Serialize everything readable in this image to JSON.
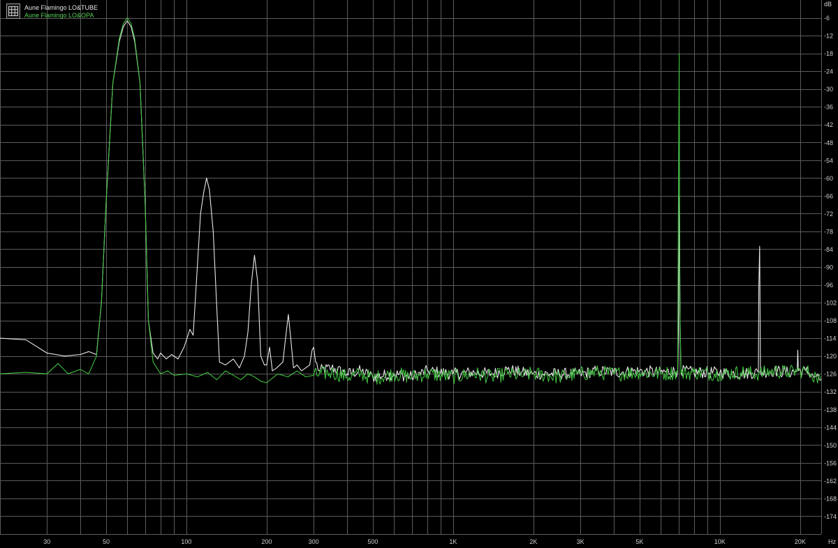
{
  "legend": {
    "icon": "grid-icon",
    "series_labels": [
      "Aune Flamingo LO&TUBE",
      "Aune Flamingo LO&OPA"
    ]
  },
  "chart_data": {
    "type": "line",
    "xscale": "log",
    "xlim": [
      20,
      24000
    ],
    "ylim": [
      -180,
      0
    ],
    "xunit": "Hz",
    "yunit": "dB",
    "x_ticks": [
      {
        "value": 30,
        "label": "30"
      },
      {
        "value": 50,
        "label": "50"
      },
      {
        "value": 100,
        "label": "100"
      },
      {
        "value": 200,
        "label": "200"
      },
      {
        "value": 300,
        "label": "300"
      },
      {
        "value": 500,
        "label": "500"
      },
      {
        "value": 1000,
        "label": "1K"
      },
      {
        "value": 2000,
        "label": "2K"
      },
      {
        "value": 3000,
        "label": "3K"
      },
      {
        "value": 5000,
        "label": "5K"
      },
      {
        "value": 10000,
        "label": "10K"
      },
      {
        "value": 20000,
        "label": "20K"
      }
    ],
    "x_gridlines": [
      20,
      30,
      40,
      50,
      60,
      70,
      80,
      90,
      100,
      200,
      300,
      400,
      500,
      600,
      700,
      800,
      900,
      1000,
      2000,
      3000,
      4000,
      5000,
      6000,
      7000,
      8000,
      9000,
      10000,
      20000
    ],
    "y_ticks": [
      -6,
      -12,
      -18,
      -24,
      -30,
      -36,
      -42,
      -48,
      -54,
      -60,
      -66,
      -72,
      -78,
      -84,
      -90,
      -96,
      -102,
      -108,
      -114,
      -120,
      -126,
      -132,
      -138,
      -144,
      -150,
      -156,
      -162,
      -168,
      -174
    ],
    "grid": true,
    "legend_position": "top-left",
    "colors": {
      "background": "#000000",
      "grid": "#5c5c5c",
      "tube": "#e8e8e8",
      "opa": "#3fbf3f",
      "axis_text": "#d0d0d0"
    },
    "series": [
      {
        "name": "Aune Flamingo LO&TUBE",
        "color": "#e8e8e8",
        "points": [
          [
            20,
            -114
          ],
          [
            25,
            -114.5
          ],
          [
            30,
            -119
          ],
          [
            35,
            -120
          ],
          [
            40,
            -119.5
          ],
          [
            43,
            -118.5
          ],
          [
            46,
            -119.5
          ],
          [
            48,
            -102
          ],
          [
            50,
            -68
          ],
          [
            53,
            -28
          ],
          [
            56,
            -14
          ],
          [
            58,
            -9
          ],
          [
            60,
            -7
          ],
          [
            62,
            -9
          ],
          [
            64,
            -14
          ],
          [
            67,
            -28
          ],
          [
            70,
            -68
          ],
          [
            72,
            -108
          ],
          [
            75,
            -119
          ],
          [
            78,
            -121
          ],
          [
            80,
            -119
          ],
          [
            84,
            -121
          ],
          [
            88,
            -119.5
          ],
          [
            93,
            -121
          ],
          [
            98,
            -117
          ],
          [
            103,
            -111
          ],
          [
            106,
            -113
          ],
          [
            110,
            -89
          ],
          [
            113,
            -72
          ],
          [
            116,
            -65
          ],
          [
            119,
            -60
          ],
          [
            122,
            -64
          ],
          [
            126,
            -78
          ],
          [
            130,
            -104
          ],
          [
            133,
            -122
          ],
          [
            140,
            -123
          ],
          [
            150,
            -121
          ],
          [
            158,
            -124
          ],
          [
            165,
            -120
          ],
          [
            170,
            -112
          ],
          [
            175,
            -96
          ],
          [
            180,
            -86
          ],
          [
            185,
            -95
          ],
          [
            190,
            -120
          ],
          [
            196,
            -123
          ],
          [
            200,
            -123
          ],
          [
            205,
            -117
          ],
          [
            210,
            -125
          ],
          [
            218,
            -124
          ],
          [
            230,
            -122
          ],
          [
            236,
            -113
          ],
          [
            241,
            -106
          ],
          [
            246,
            -114
          ],
          [
            252,
            -124
          ],
          [
            260,
            -123
          ],
          [
            270,
            -125
          ],
          [
            280,
            -124
          ],
          [
            290,
            -123
          ],
          [
            296,
            -118
          ],
          [
            300,
            -117
          ],
          [
            305,
            -122
          ],
          [
            315,
            -125
          ],
          [
            350,
            -124
          ],
          [
            400,
            -126
          ],
          [
            450,
            -125
          ],
          [
            500,
            -127
          ],
          [
            600,
            -126
          ],
          [
            700,
            -127
          ],
          [
            800,
            -125
          ],
          [
            1000,
            -126
          ],
          [
            1200,
            -125.5
          ],
          [
            1400,
            -126
          ],
          [
            1600,
            -124.5
          ],
          [
            1800,
            -125.5
          ],
          [
            2000,
            -126
          ],
          [
            2500,
            -126
          ],
          [
            3000,
            -126
          ],
          [
            3500,
            -125
          ],
          [
            4000,
            -125.5
          ],
          [
            5000,
            -125
          ],
          [
            6000,
            -125.5
          ],
          [
            6950,
            -125
          ],
          [
            7000,
            -109
          ],
          [
            7050,
            -66
          ],
          [
            7100,
            -110
          ],
          [
            7150,
            -125
          ],
          [
            8000,
            -125.5
          ],
          [
            10000,
            -125.5
          ],
          [
            12000,
            -126
          ],
          [
            13950,
            -125.5
          ],
          [
            14000,
            -97
          ],
          [
            14100,
            -83
          ],
          [
            14200,
            -125.5
          ],
          [
            16000,
            -125
          ],
          [
            18000,
            -125.5
          ],
          [
            19500,
            -125
          ],
          [
            19600,
            -118
          ],
          [
            19700,
            -125
          ],
          [
            21000,
            -125
          ],
          [
            22000,
            -126
          ],
          [
            23000,
            -127
          ],
          [
            24000,
            -128
          ]
        ]
      },
      {
        "name": "Aune Flamingo LO&OPA",
        "color": "#3fbf3f",
        "points": [
          [
            20,
            -126
          ],
          [
            25,
            -125.5
          ],
          [
            30,
            -126
          ],
          [
            33,
            -122.5
          ],
          [
            36,
            -126
          ],
          [
            40,
            -124.5
          ],
          [
            43,
            -126
          ],
          [
            46,
            -120
          ],
          [
            48,
            -102
          ],
          [
            50,
            -68
          ],
          [
            53,
            -28
          ],
          [
            56,
            -13
          ],
          [
            58,
            -8
          ],
          [
            60,
            -6
          ],
          [
            62,
            -8
          ],
          [
            64,
            -13
          ],
          [
            67,
            -28
          ],
          [
            70,
            -68
          ],
          [
            72,
            -108
          ],
          [
            75,
            -122
          ],
          [
            80,
            -126
          ],
          [
            85,
            -125
          ],
          [
            90,
            -126.5
          ],
          [
            100,
            -126
          ],
          [
            110,
            -127
          ],
          [
            120,
            -125.5
          ],
          [
            130,
            -128
          ],
          [
            140,
            -125
          ],
          [
            150,
            -126.5
          ],
          [
            160,
            -128
          ],
          [
            170,
            -126
          ],
          [
            180,
            -127
          ],
          [
            190,
            -128.5
          ],
          [
            200,
            -129
          ],
          [
            220,
            -126
          ],
          [
            240,
            -127
          ],
          [
            260,
            -125
          ],
          [
            280,
            -127
          ],
          [
            300,
            -126.5
          ],
          [
            350,
            -125.5
          ],
          [
            400,
            -127
          ],
          [
            450,
            -126
          ],
          [
            500,
            -127.5
          ],
          [
            600,
            -126
          ],
          [
            700,
            -127
          ],
          [
            800,
            -126
          ],
          [
            1000,
            -127
          ],
          [
            1200,
            -126
          ],
          [
            1400,
            -127
          ],
          [
            1600,
            -126
          ],
          [
            1800,
            -126.5
          ],
          [
            2000,
            -126
          ],
          [
            2500,
            -127
          ],
          [
            3000,
            -126
          ],
          [
            3500,
            -125.5
          ],
          [
            4000,
            -126
          ],
          [
            5000,
            -125.5
          ],
          [
            6000,
            -126
          ],
          [
            6950,
            -125.5
          ],
          [
            7000,
            -60
          ],
          [
            7040,
            -18
          ],
          [
            7080,
            -100
          ],
          [
            7150,
            -126
          ],
          [
            8000,
            -125.5
          ],
          [
            10000,
            -126
          ],
          [
            12000,
            -125.5
          ],
          [
            14000,
            -126
          ],
          [
            16000,
            -125
          ],
          [
            18000,
            -125.5
          ],
          [
            20000,
            -125
          ],
          [
            21000,
            -125
          ],
          [
            22000,
            -126
          ],
          [
            23000,
            -127
          ],
          [
            24000,
            -128
          ]
        ]
      }
    ]
  }
}
